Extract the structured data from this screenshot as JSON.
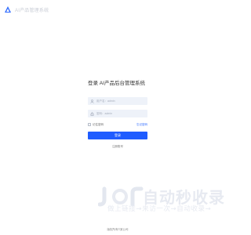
{
  "header": {
    "logo_icon": "triangle-logo-icon",
    "brand_text": "AI产品管理系统",
    "accent_color": "#2f6bff"
  },
  "login": {
    "title": "登录 AI产品后台管理系统",
    "username": {
      "placeholder": "用户名：admin",
      "icon": "user-icon",
      "value": ""
    },
    "password": {
      "placeholder": "密码：admin",
      "icon": "lock-icon",
      "value": ""
    },
    "remember_label": "记住密码",
    "forgot_label": "忘记密码",
    "submit_label": "登录",
    "register_label": "注册账号",
    "button_color": "#1f5cff"
  },
  "watermark": {
    "title": "自动秒收录",
    "subtitle": "做上链接→来访一次→自动收录→"
  },
  "footer": {
    "text": "版权所有©某公司"
  }
}
